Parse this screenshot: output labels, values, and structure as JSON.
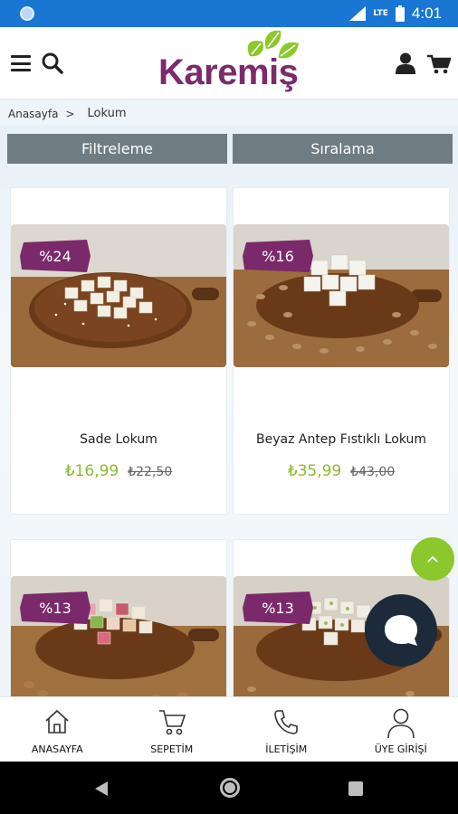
{
  "statusbar": {
    "network": "LTE",
    "time": "4:01"
  },
  "header": {
    "logo_text": "Karemiş"
  },
  "breadcrumb": {
    "home": "Anasayfa",
    "separator": ">",
    "current": "Lokum"
  },
  "toolbar": {
    "filter_label": "Filtreleme",
    "sort_label": "Sıralama"
  },
  "products": [
    {
      "name": "Sade Lokum",
      "price": "₺16,99",
      "old_price": "₺22,50",
      "discount": "%24"
    },
    {
      "name": "Beyaz Antep Fıstıklı Lokum",
      "price": "₺35,99",
      "old_price": "₺43,00",
      "discount": "%16"
    },
    {
      "discount": "%13"
    },
    {
      "discount": "%13"
    }
  ],
  "bottom_nav": [
    {
      "label": "ANASAYFA",
      "icon": "home-icon"
    },
    {
      "label": "SEPETİM",
      "icon": "cart-icon"
    },
    {
      "label": "İLETİŞİM",
      "icon": "phone-icon"
    },
    {
      "label": "ÜYE GİRİŞİ",
      "icon": "user-icon"
    }
  ],
  "colors": {
    "brand": "#7d2a6c",
    "leaf": "#8cc82c",
    "price": "#8bbb2b",
    "badge": "#7a2a6a",
    "statusbar": "#1976d2",
    "button": "#6f7c84"
  }
}
